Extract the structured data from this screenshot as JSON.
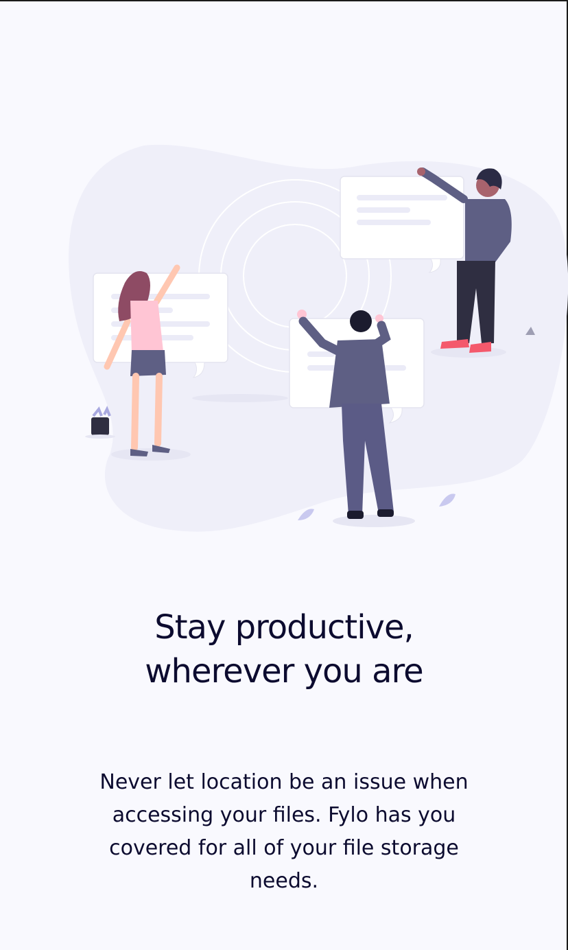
{
  "section": {
    "headline_line1": "Stay productive,",
    "headline_line2": "wherever you are",
    "body": "Never let location be an issue when accessing your files. Fylo has you covered for all of your file storage needs."
  },
  "colors": {
    "background": "#f9f9fe",
    "text": "#0c0b2f",
    "blob": "#efeff9",
    "card": "#ffffff",
    "card_lines": "#ebebf7",
    "suit": "#5e5f84",
    "accent": "#a9a9e0"
  },
  "illustration": {
    "icon": "people-chat-bubbles-illustration"
  }
}
